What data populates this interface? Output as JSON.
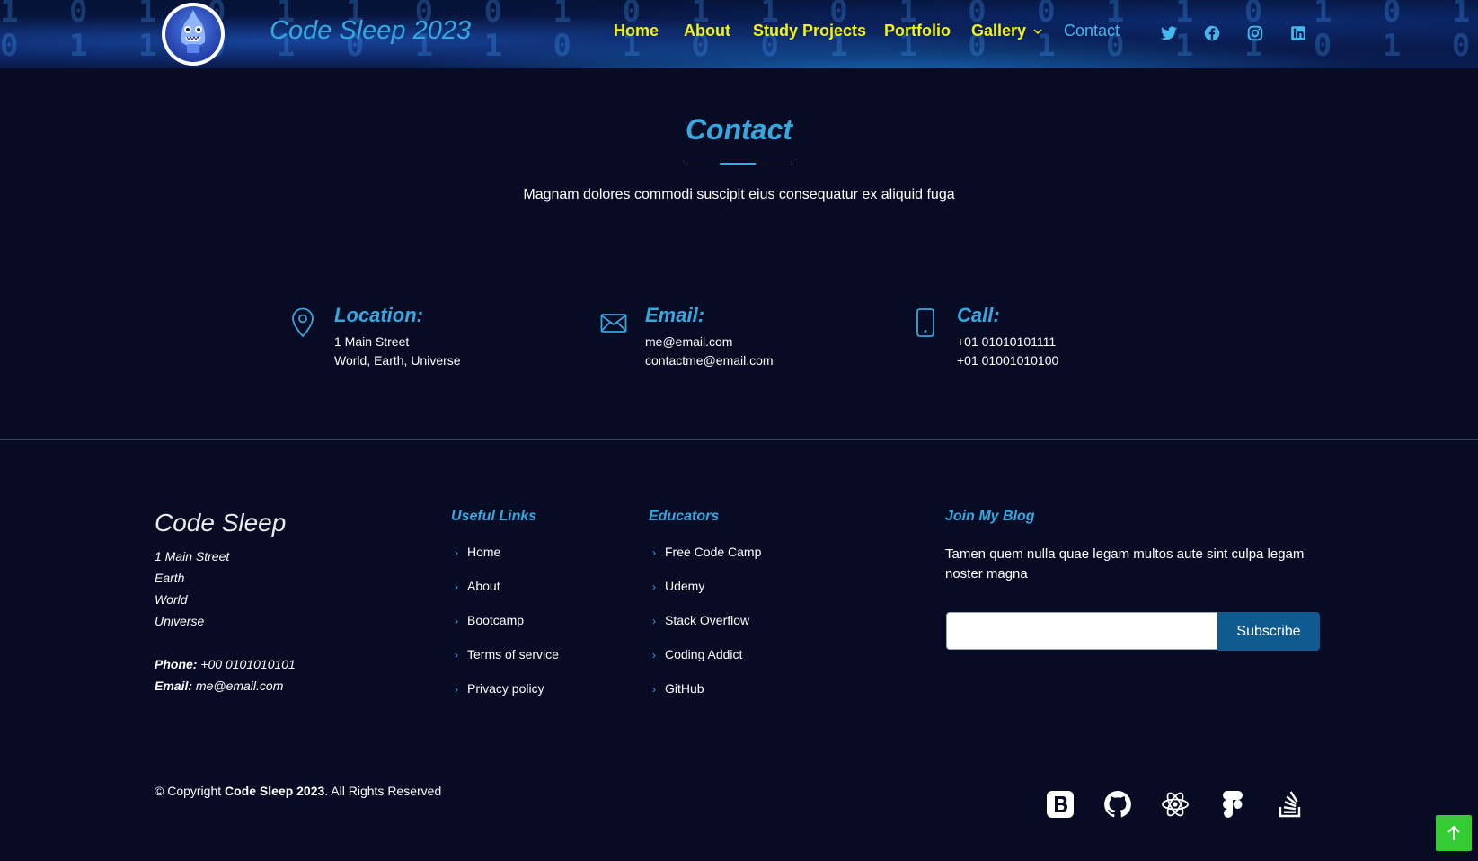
{
  "header": {
    "site_title": "Code Sleep 2023",
    "binary_rows": [
      "1 0 1  0 1 1 0 0 1 0 1 1 0 1 0 0 1 1 0 1 0 1 1 0 0 1 0 1 0 1",
      "0 1 1 0 1 0 1 1 0 1 0 0 1 1 0 1 0 1 1 0 1 0 0 1 1 0 1 0 1 1"
    ],
    "nav": [
      {
        "label": "Home"
      },
      {
        "label": "About"
      },
      {
        "label": "Study Projects"
      },
      {
        "label": "Portfolio"
      },
      {
        "label": "Gallery"
      },
      {
        "label": "Contact",
        "active": true
      }
    ],
    "social_icons": [
      "twitter-icon",
      "facebook-icon",
      "instagram-icon",
      "linkedin-icon"
    ]
  },
  "contact": {
    "title": "Contact",
    "subtitle": "Magnam dolores commodi suscipit eius consequatur ex aliquid fuga",
    "location": {
      "heading": "Location:",
      "line1": "1 Main Street",
      "line2": "World, Earth, Universe",
      "icon": "map-pin-icon"
    },
    "email": {
      "heading": "Email:",
      "line1": "me@email.com",
      "line2": "contactme@email.com",
      "icon": "envelope-icon"
    },
    "call": {
      "heading": "Call:",
      "line1": "+01 01010101111",
      "line2": "+01 01001010100",
      "icon": "phone-icon"
    }
  },
  "footer": {
    "brand": "Code Sleep",
    "address": [
      "1 Main Street",
      "Earth",
      "World",
      "Universe"
    ],
    "phone_label": "Phone:",
    "phone": "+00 0101010101",
    "email_label": "Email:",
    "email": "me@email.com",
    "useful_links": {
      "heading": "Useful Links",
      "items": [
        "Home",
        "About",
        "Bootcamp",
        "Terms of service",
        "Privacy policy"
      ]
    },
    "educators": {
      "heading": "Educators",
      "items": [
        "Free Code Camp",
        "Udemy",
        "Stack Overflow",
        "Coding Addict",
        "GitHub"
      ]
    },
    "blog": {
      "heading": "Join My Blog",
      "text": "Tamen quem nulla quae legam multos aute sint culpa legam noster magna",
      "input_value": "",
      "button": "Subscribe"
    },
    "copyright_prefix": "© Copyright ",
    "copyright_brand": "Code Sleep 2023",
    "copyright_suffix": ". All Rights Reserved",
    "tech_icons": [
      "bootstrap-icon",
      "github-icon",
      "react-icon",
      "figma-icon",
      "stack-overflow-icon"
    ]
  },
  "colors": {
    "background": "#070b24",
    "accent": "#35a8e0",
    "nav_text": "#f3f312",
    "scroll_top": "#33cc33",
    "subscribe": "#0f5a8f"
  }
}
